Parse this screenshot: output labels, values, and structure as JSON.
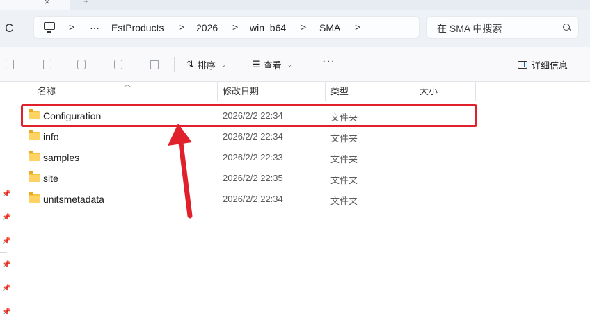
{
  "tabbar": {
    "close_glyph": "×",
    "add_glyph": "+"
  },
  "address": {
    "overflow": "···",
    "crumbs": [
      "EstProducts",
      "2026",
      "win_b64",
      "SMA"
    ],
    "chevron": ">"
  },
  "search": {
    "placeholder": "在 SMA 中搜索"
  },
  "toolbar": {
    "sort_label": "排序",
    "view_label": "查看",
    "more_label": "···",
    "details_label": "详细信息"
  },
  "columns": {
    "name": "名称",
    "modified": "修改日期",
    "type": "类型",
    "size": "大小"
  },
  "files": [
    {
      "name": "Configuration",
      "modified": "2026/2/2 22:34",
      "type": "文件夹"
    },
    {
      "name": "info",
      "modified": "2026/2/2 22:34",
      "type": "文件夹"
    },
    {
      "name": "samples",
      "modified": "2026/2/2 22:33",
      "type": "文件夹"
    },
    {
      "name": "site",
      "modified": "2026/2/2 22:35",
      "type": "文件夹"
    },
    {
      "name": "unitsmetadata",
      "modified": "2026/2/2 22:34",
      "type": "文件夹"
    }
  ],
  "colors": {
    "highlight": "#e0202a",
    "folder": "#f6c343",
    "address_bg": "#eef1f6"
  }
}
